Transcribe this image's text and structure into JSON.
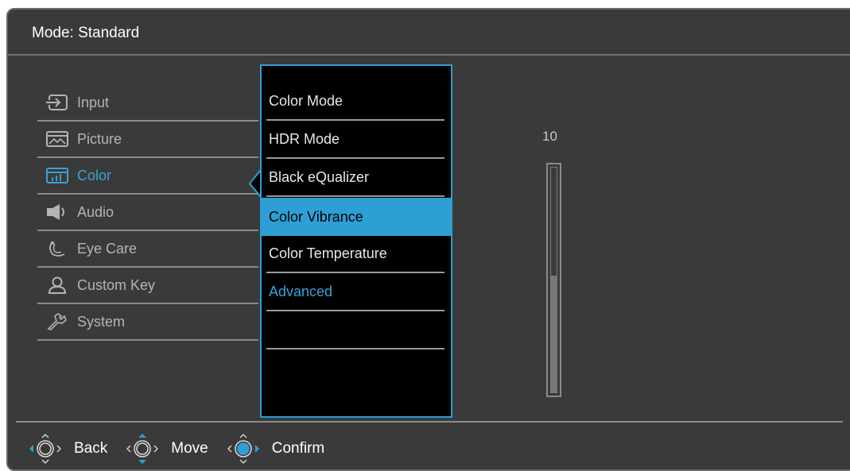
{
  "header": {
    "mode_label": "Mode: Standard"
  },
  "menu": {
    "items": [
      {
        "label": "Input",
        "icon": "input-icon"
      },
      {
        "label": "Picture",
        "icon": "picture-icon"
      },
      {
        "label": "Color",
        "icon": "color-icon",
        "active": true
      },
      {
        "label": "Audio",
        "icon": "speaker-icon"
      },
      {
        "label": "Eye Care",
        "icon": "eye-care-icon"
      },
      {
        "label": "Custom Key",
        "icon": "user-icon"
      },
      {
        "label": "System",
        "icon": "wrench-icon"
      }
    ]
  },
  "submenu": {
    "items": [
      {
        "label": "Color Mode"
      },
      {
        "label": "HDR Mode"
      },
      {
        "label": "Black eQualizer"
      },
      {
        "label": "Color Vibrance",
        "selected": true
      },
      {
        "label": "Color Temperature"
      },
      {
        "label": "Advanced",
        "link": true
      },
      {
        "label": ""
      },
      {
        "label": ""
      }
    ]
  },
  "value": {
    "display": "10",
    "level_fraction": 0.52
  },
  "footer": {
    "back_label": "Back",
    "move_label": "Move",
    "confirm_label": "Confirm"
  },
  "colors": {
    "accent": "#2e9fd4",
    "background": "#3a3a3a",
    "submenu_bg": "#000000"
  }
}
